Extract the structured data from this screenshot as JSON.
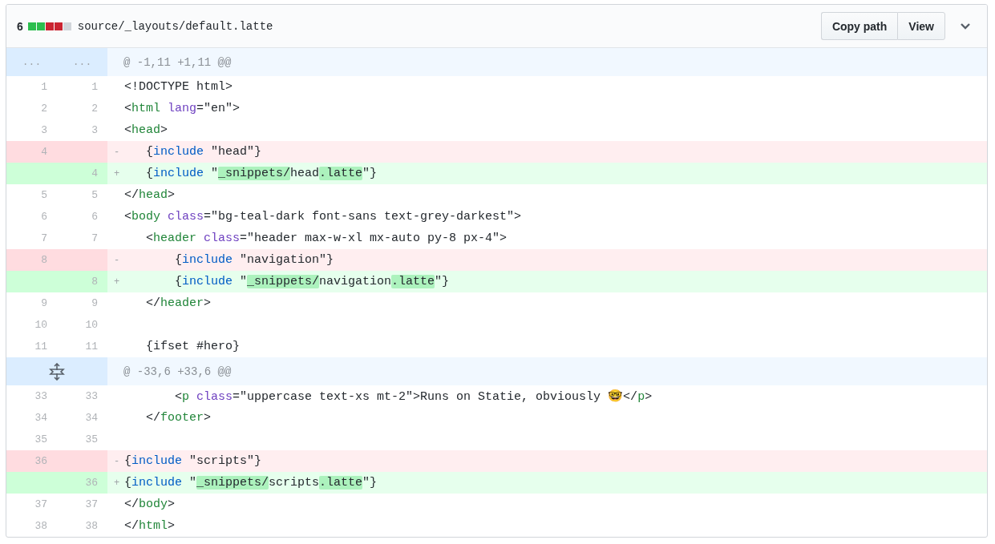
{
  "file_header": {
    "change_count": "6",
    "diffstat": [
      {
        "color": "#2cbe4e"
      },
      {
        "color": "#2cbe4e"
      },
      {
        "color": "#cb2431"
      },
      {
        "color": "#cb2431"
      },
      {
        "color": "#d1d5da"
      }
    ],
    "path": "source/_layouts/default.latte",
    "buttons": [
      "Copy path",
      "View"
    ],
    "expanded": true
  },
  "rows": [
    {
      "kind": "hunk",
      "old": "...",
      "new": "...",
      "text": "@ -1,11 +1,11 @@"
    },
    {
      "kind": "context",
      "old": "1",
      "new": "1",
      "tokens": [
        {
          "kind": "text",
          "text": "<!DOCTYPE html>"
        }
      ]
    },
    {
      "kind": "context",
      "old": "2",
      "new": "2",
      "tokens": [
        {
          "kind": "text",
          "text": "<"
        },
        {
          "kind": "tag",
          "text": "html"
        },
        {
          "kind": "attr",
          "text": " lang"
        },
        {
          "kind": "text",
          "text": "=\"en\">"
        }
      ]
    },
    {
      "kind": "context",
      "old": "3",
      "new": "3",
      "tokens": [
        {
          "kind": "text",
          "text": "<"
        },
        {
          "kind": "tag",
          "text": "head"
        },
        {
          "kind": "text",
          "text": ">"
        }
      ]
    },
    {
      "kind": "deletion",
      "old": "4",
      "marker": "-",
      "tokens": [
        {
          "kind": "text",
          "text": "   {"
        },
        {
          "kind": "keyword",
          "text": "include"
        },
        {
          "kind": "text",
          "text": " \"head\"}"
        }
      ]
    },
    {
      "kind": "addition",
      "new": "4",
      "marker": "+",
      "tokens": [
        {
          "kind": "text",
          "text": "   {"
        },
        {
          "kind": "keyword",
          "text": "include"
        },
        {
          "kind": "text",
          "text": " \""
        },
        {
          "kind": "highlight",
          "text": "_snippets/"
        },
        {
          "kind": "text",
          "text": "head"
        },
        {
          "kind": "highlight",
          "text": ".latte"
        },
        {
          "kind": "text",
          "text": "\"}"
        }
      ]
    },
    {
      "kind": "context",
      "old": "5",
      "new": "5",
      "tokens": [
        {
          "kind": "text",
          "text": "</"
        },
        {
          "kind": "tag",
          "text": "head"
        },
        {
          "kind": "text",
          "text": ">"
        }
      ]
    },
    {
      "kind": "context",
      "old": "6",
      "new": "6",
      "tokens": [
        {
          "kind": "text",
          "text": "<"
        },
        {
          "kind": "tag",
          "text": "body"
        },
        {
          "kind": "attr",
          "text": " class"
        },
        {
          "kind": "text",
          "text": "=\"bg-teal-dark font-sans text-grey-darkest\">"
        }
      ]
    },
    {
      "kind": "context",
      "old": "7",
      "new": "7",
      "tokens": [
        {
          "kind": "text",
          "text": "   <"
        },
        {
          "kind": "tag",
          "text": "header"
        },
        {
          "kind": "attr",
          "text": " class"
        },
        {
          "kind": "text",
          "text": "=\"header max-w-xl mx-auto py-8 px-4\">"
        }
      ]
    },
    {
      "kind": "deletion",
      "old": "8",
      "marker": "-",
      "tokens": [
        {
          "kind": "text",
          "text": "       {"
        },
        {
          "kind": "keyword",
          "text": "include"
        },
        {
          "kind": "text",
          "text": " \"navigation\"}"
        }
      ]
    },
    {
      "kind": "addition",
      "new": "8",
      "marker": "+",
      "tokens": [
        {
          "kind": "text",
          "text": "       {"
        },
        {
          "kind": "keyword",
          "text": "include"
        },
        {
          "kind": "text",
          "text": " \""
        },
        {
          "kind": "highlight",
          "text": "_snippets/"
        },
        {
          "kind": "text",
          "text": "navigation"
        },
        {
          "kind": "highlight",
          "text": ".latte"
        },
        {
          "kind": "text",
          "text": "\"}"
        }
      ]
    },
    {
      "kind": "context",
      "old": "9",
      "new": "9",
      "tokens": [
        {
          "kind": "text",
          "text": "   </"
        },
        {
          "kind": "tag",
          "text": "header"
        },
        {
          "kind": "text",
          "text": ">"
        }
      ]
    },
    {
      "kind": "context",
      "old": "10",
      "new": "10",
      "tokens": []
    },
    {
      "kind": "context",
      "old": "11",
      "new": "11",
      "tokens": [
        {
          "kind": "text",
          "text": "   {ifset #hero}"
        }
      ]
    },
    {
      "kind": "hunk",
      "expand": true,
      "text": "@ -33,6 +33,6 @@"
    },
    {
      "kind": "context",
      "old": "33",
      "new": "33",
      "tokens": [
        {
          "kind": "text",
          "text": "       <"
        },
        {
          "kind": "tag",
          "text": "p"
        },
        {
          "kind": "attr",
          "text": " class"
        },
        {
          "kind": "text",
          "text": "=\"uppercase text-xs mt-2\">Runs on Statie, obviously 🤓</"
        },
        {
          "kind": "tag",
          "text": "p"
        },
        {
          "kind": "text",
          "text": ">"
        }
      ]
    },
    {
      "kind": "context",
      "old": "34",
      "new": "34",
      "tokens": [
        {
          "kind": "text",
          "text": "   </"
        },
        {
          "kind": "tag",
          "text": "footer"
        },
        {
          "kind": "text",
          "text": ">"
        }
      ]
    },
    {
      "kind": "context",
      "old": "35",
      "new": "35",
      "tokens": []
    },
    {
      "kind": "deletion",
      "old": "36",
      "marker": "-",
      "tokens": [
        {
          "kind": "text",
          "text": "{"
        },
        {
          "kind": "keyword",
          "text": "include"
        },
        {
          "kind": "text",
          "text": " \"scripts\"}"
        }
      ]
    },
    {
      "kind": "addition",
      "new": "36",
      "marker": "+",
      "tokens": [
        {
          "kind": "text",
          "text": "{"
        },
        {
          "kind": "keyword",
          "text": "include"
        },
        {
          "kind": "text",
          "text": " \""
        },
        {
          "kind": "highlight",
          "text": "_snippets/"
        },
        {
          "kind": "text",
          "text": "scripts"
        },
        {
          "kind": "highlight",
          "text": ".latte"
        },
        {
          "kind": "text",
          "text": "\"}"
        }
      ]
    },
    {
      "kind": "context",
      "old": "37",
      "new": "37",
      "tokens": [
        {
          "kind": "text",
          "text": "</"
        },
        {
          "kind": "tag",
          "text": "body"
        },
        {
          "kind": "text",
          "text": ">"
        }
      ]
    },
    {
      "kind": "context",
      "old": "38",
      "new": "38",
      "tokens": [
        {
          "kind": "text",
          "text": "</"
        },
        {
          "kind": "tag",
          "text": "html"
        },
        {
          "kind": "text",
          "text": ">"
        }
      ]
    }
  ]
}
